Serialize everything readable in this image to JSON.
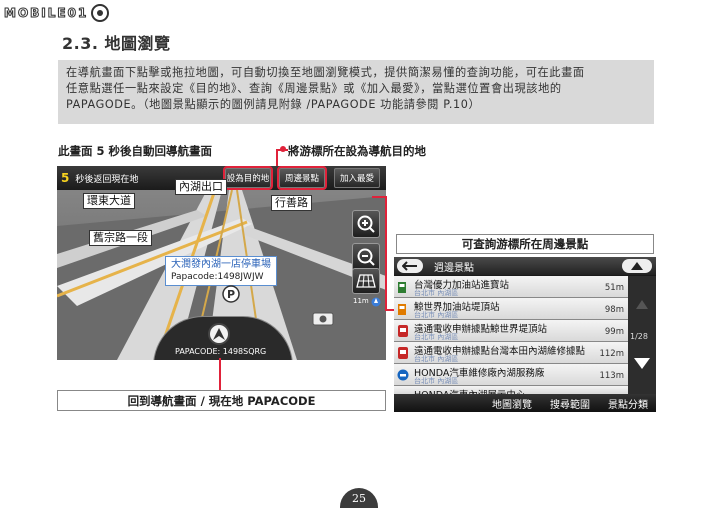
{
  "logo": {
    "text": "MOBILE01"
  },
  "section": {
    "title": "2.3. 地圖瀏覽"
  },
  "intro": {
    "lines": [
      "在導航畫面下點擊或拖拉地圖，可自動切換至地圖瀏覽模式，提供簡潔易懂的查詢功能，可在此畫面",
      "任意點選任一點來設定《目的地》、查詢《周邊景點》或《加入最愛》，當點選位置會出現該地的",
      "PAPAGODE。（地圖景點顯示的圖例請見附錄 /PAPAGODE 功能請參閱 P.10）"
    ]
  },
  "captions": {
    "left": "此畫面 5 秒後自動回導航畫面",
    "target": "將游標所在設為導航目的地",
    "nearby": "可查詢游標所在周邊景點",
    "bottom": "回到導航畫面 / 現在地 PAPACODE"
  },
  "nav": {
    "countdown_num": "5",
    "countdown_text": "秒後返回現在地",
    "buttons": [
      "設為目的地",
      "周邊景點",
      "加入最愛"
    ],
    "roads": [
      "內湖出口",
      "環東大道",
      "行善路",
      "舊宗路一段"
    ],
    "poi_name": "大潤發內湖一店停車場",
    "poi_code": "Papacode:1498JWJW",
    "scale": "11m",
    "papacode": "PAPACODE: 1498SQRG"
  },
  "nearby": {
    "title": "週邊景點",
    "page": "1/28",
    "items": [
      {
        "name": "台灣優力加油站進寶站",
        "addr": "台北市 內湖區",
        "dist": "51m",
        "icon": "fuel"
      },
      {
        "name": "鯨世界加油站堤頂站",
        "addr": "台北市 內湖區",
        "dist": "98m",
        "icon": "fuel"
      },
      {
        "name": "遠通電收申辦據點鯨世界堤頂站",
        "addr": "台北市 內湖區",
        "dist": "99m",
        "icon": "etc"
      },
      {
        "name": "遠通電收申辦據點台灣本田內湖維修據點",
        "addr": "台北市 內湖區",
        "dist": "112m",
        "icon": "etc"
      },
      {
        "name": "HONDA汽車維修廠內湖服務廠",
        "addr": "台北市 內湖區",
        "dist": "113m",
        "icon": "car"
      }
    ],
    "partial_item": "HONDA汽車內湖展示中心",
    "footer": [
      "地圖瀏覽",
      "搜尋範圍",
      "景點分類"
    ]
  },
  "page_number": "25"
}
